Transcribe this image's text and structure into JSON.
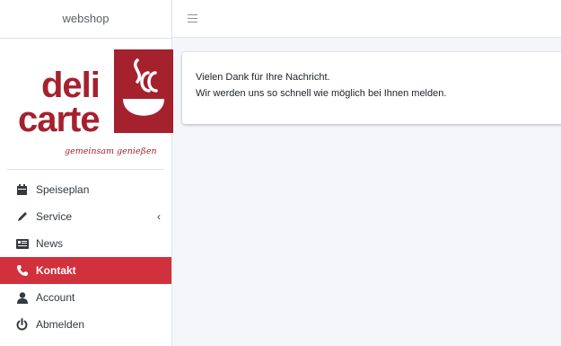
{
  "sidebar": {
    "brand": "webshop",
    "logo": {
      "line1": "deli",
      "line2": "carte",
      "tagline": "gemeinsam genießen"
    },
    "items": [
      {
        "label": "Speiseplan",
        "icon": "calendar-icon",
        "active": false
      },
      {
        "label": "Service",
        "icon": "pencil-icon",
        "active": false,
        "has_submenu": true
      },
      {
        "label": "News",
        "icon": "newspaper-icon",
        "active": false
      },
      {
        "label": "Kontakt",
        "icon": "phone-icon",
        "active": true
      },
      {
        "label": "Account",
        "icon": "user-icon",
        "active": false
      },
      {
        "label": "Abmelden",
        "icon": "power-icon",
        "active": false
      }
    ]
  },
  "topbar": {
    "menu_icon": "hamburger-menu-icon"
  },
  "main": {
    "message": {
      "line1": "Vielen Dank für Ihre Nachricht.",
      "line2": "Wir werden uns so schnell wie möglich bei Ihnen melden."
    }
  },
  "colors": {
    "brand_red": "#a5212e",
    "active_red": "#d1313d",
    "text": "#343a40",
    "background": "#f4f6f9"
  }
}
